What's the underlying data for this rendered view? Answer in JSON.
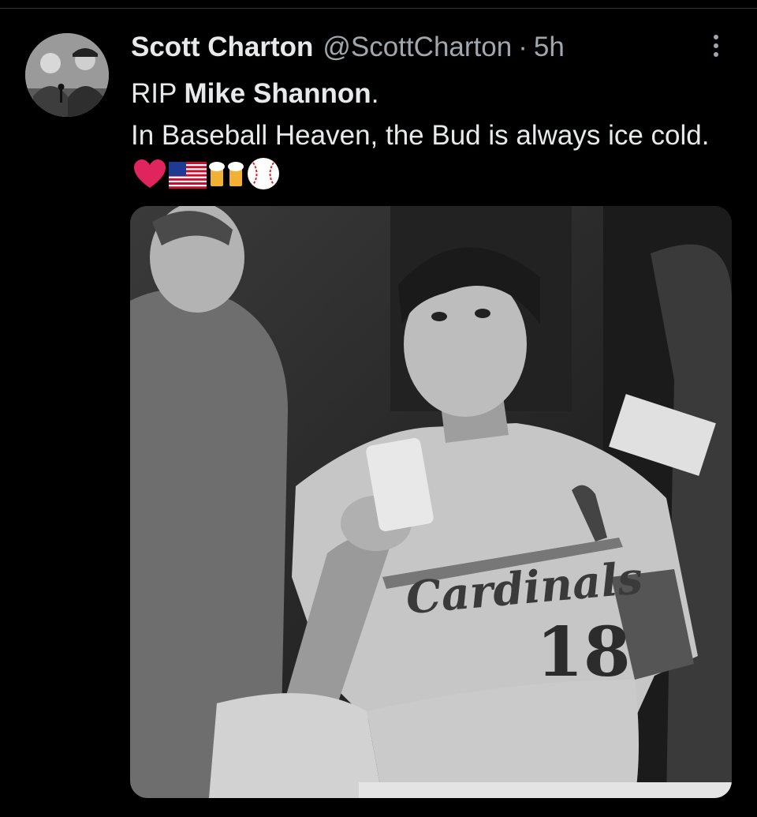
{
  "tweet": {
    "author_name": "Scott Charton",
    "handle": "@ScottCharton",
    "separator": "·",
    "time": "5h",
    "text_prefix": "RIP ",
    "text_bold": "Mike Shannon",
    "text_after_bold": ".",
    "text_line2": "In Baseball Heaven, the Bud is always ice cold.",
    "emojis": [
      "heart-icon",
      "us-flag-icon",
      "beer-mugs-icon",
      "baseball-icon"
    ]
  },
  "photo": {
    "jersey_text": "Cardinals",
    "jersey_number": "18"
  },
  "colors": {
    "background": "#000000",
    "text_primary": "#e7e9ea",
    "text_secondary": "#a0a7ad",
    "heart": "#e0245e"
  }
}
